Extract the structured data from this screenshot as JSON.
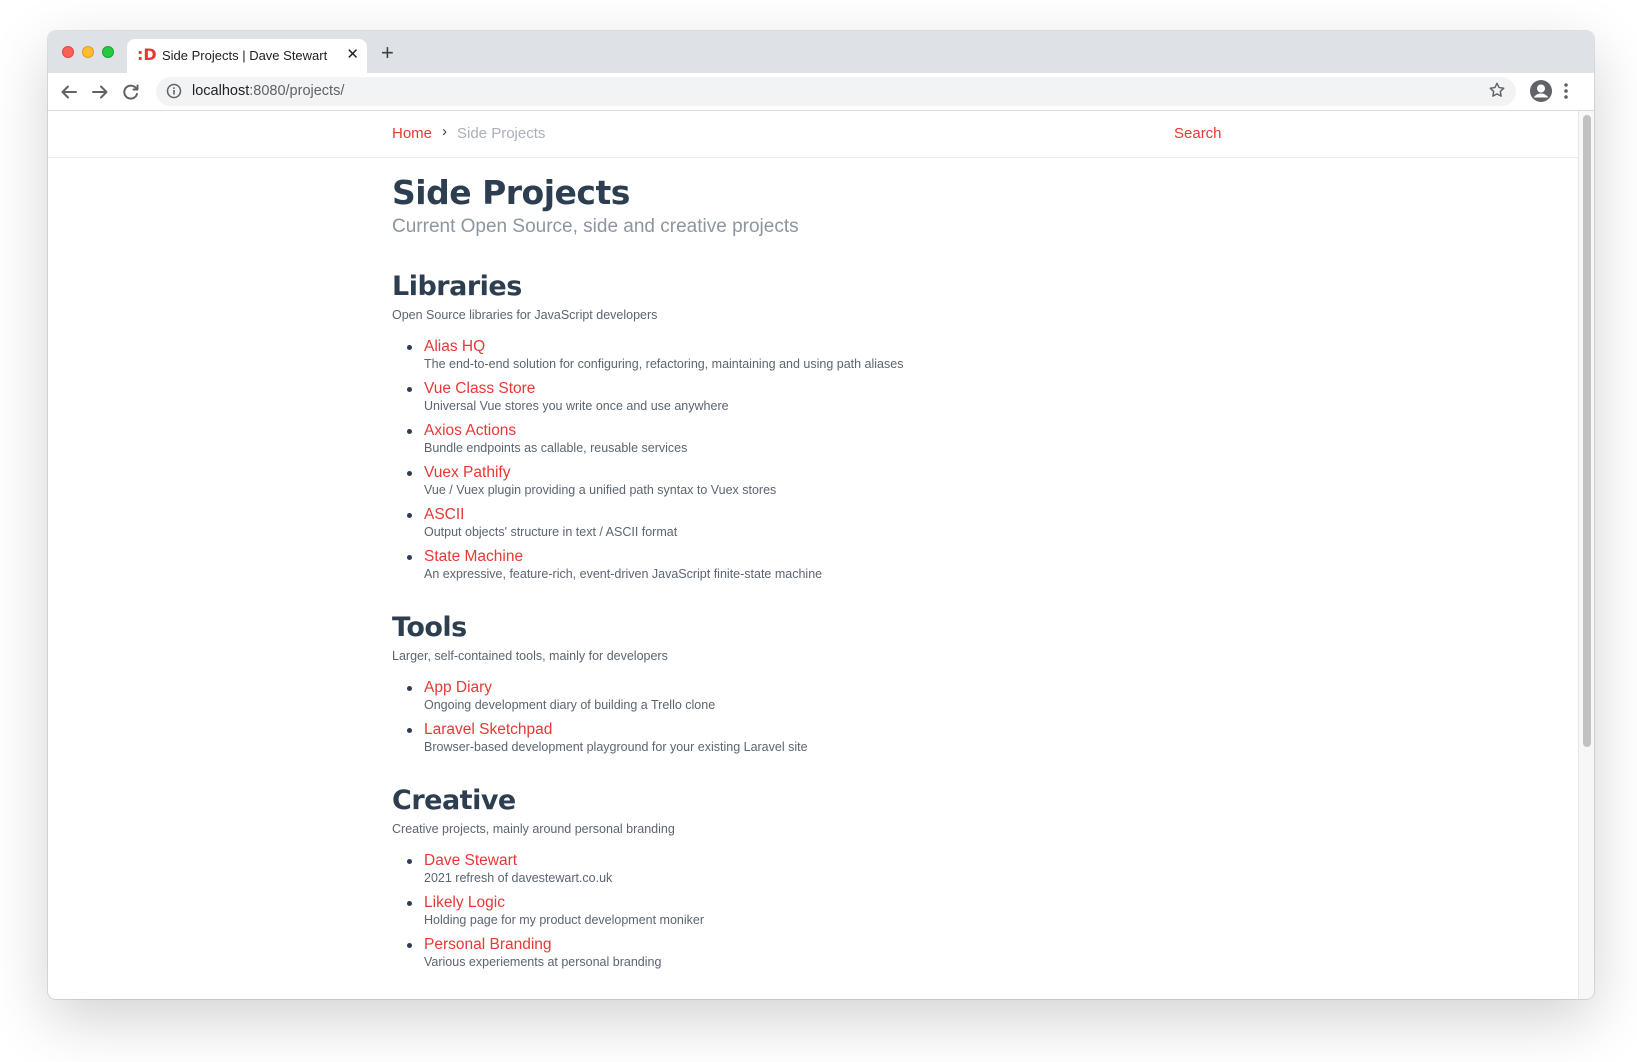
{
  "browser": {
    "tab_title": "Side Projects | Dave Stewart",
    "favicon_text": ":D",
    "url_host": "localhost",
    "url_path": ":8080/projects/",
    "new_tab_glyph": "+",
    "close_glyph": "✕"
  },
  "header": {
    "home_label": "Home",
    "separator": "›",
    "current_label": "Side Projects",
    "search_label": "Search"
  },
  "page": {
    "title": "Side Projects",
    "subtitle": "Current Open Source, side and creative projects"
  },
  "sections": [
    {
      "title": "Libraries",
      "description": "Open Source libraries for JavaScript developers",
      "items": [
        {
          "name": "Alias HQ",
          "description": "The end-to-end solution for configuring, refactoring, maintaining and using path aliases"
        },
        {
          "name": "Vue Class Store",
          "description": "Universal Vue stores you write once and use anywhere"
        },
        {
          "name": "Axios Actions",
          "description": "Bundle endpoints as callable, reusable services"
        },
        {
          "name": "Vuex Pathify",
          "description": "Vue / Vuex plugin providing a unified path syntax to Vuex stores"
        },
        {
          "name": "ASCII",
          "description": "Output objects' structure in text / ASCII format"
        },
        {
          "name": "State Machine",
          "description": "An expressive, feature-rich, event-driven JavaScript finite-state machine"
        }
      ]
    },
    {
      "title": "Tools",
      "description": "Larger, self-contained tools, mainly for developers",
      "items": [
        {
          "name": "App Diary",
          "description": "Ongoing development diary of building a Trello clone"
        },
        {
          "name": "Laravel Sketchpad",
          "description": "Browser-based development playground for your existing Laravel site"
        }
      ]
    },
    {
      "title": "Creative",
      "description": "Creative projects, mainly around personal branding",
      "items": [
        {
          "name": "Dave Stewart",
          "description": "2021 refresh of davestewart.co.uk"
        },
        {
          "name": "Likely Logic",
          "description": "Holding page for my product development moniker"
        },
        {
          "name": "Personal Branding",
          "description": "Various experiements at personal branding"
        }
      ]
    }
  ],
  "colors": {
    "accent": "#e53935",
    "heading": "#2c3e50",
    "muted": "#8c96a0"
  }
}
